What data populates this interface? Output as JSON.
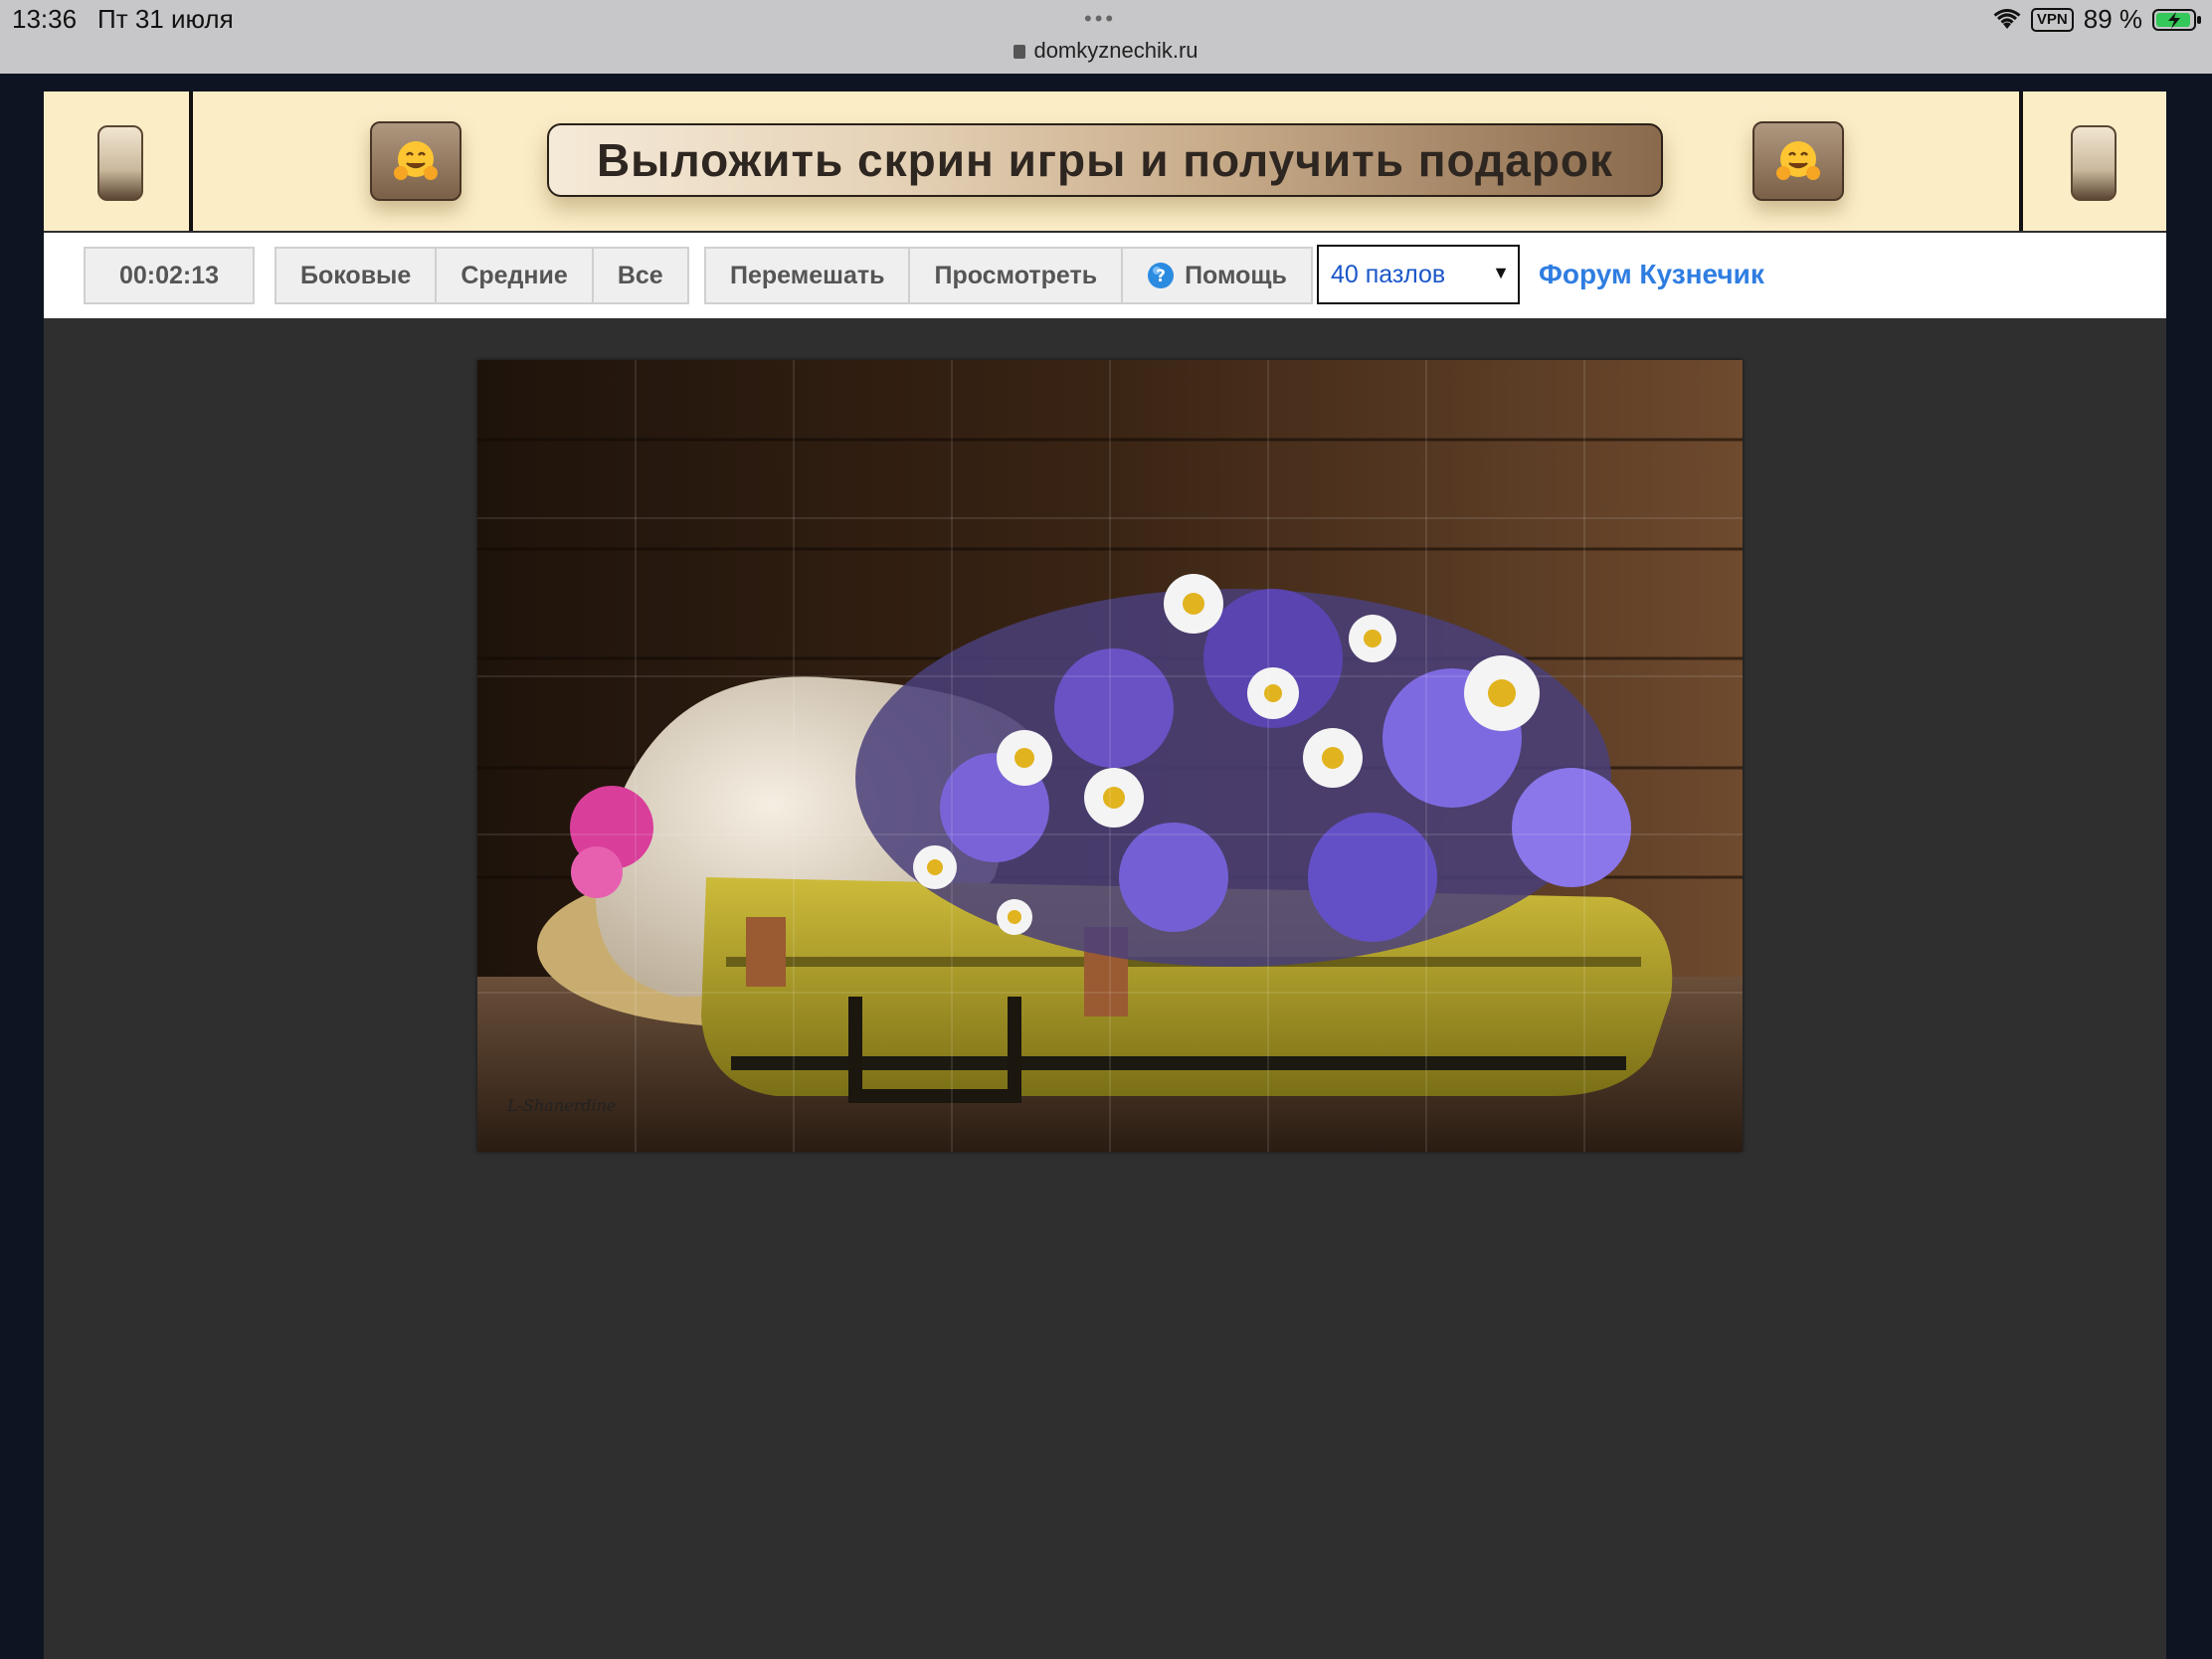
{
  "status_bar": {
    "time": "13:36",
    "date": "Пт 31 июля",
    "dots": "•••",
    "url": "domkyznechik.ru",
    "vpn": "VPN",
    "battery": "89 %"
  },
  "banner": {
    "promo_label": "Выложить скрин игры и получить подарок",
    "emoji_icon": "hugging-face-icon"
  },
  "toolbar": {
    "timer": "00:02:13",
    "filters": [
      "Боковые",
      "Средние",
      "Все"
    ],
    "actions": {
      "shuffle": "Перемешать",
      "preview": "Просмотреть",
      "help": "Помощь"
    },
    "pieces_select": {
      "value": "40 пазлов",
      "arrow": "▼"
    },
    "forum_link": "Форум Кузнечик"
  },
  "puzzle": {
    "image_signature": "L-Shanerdine",
    "grid_cols": 8,
    "grid_rows": 5
  },
  "colors": {
    "banner_bg": "#fbedc6",
    "page_bg": "#2f2f2f",
    "outer_bg": "#0f1422",
    "link": "#2f7de1"
  }
}
